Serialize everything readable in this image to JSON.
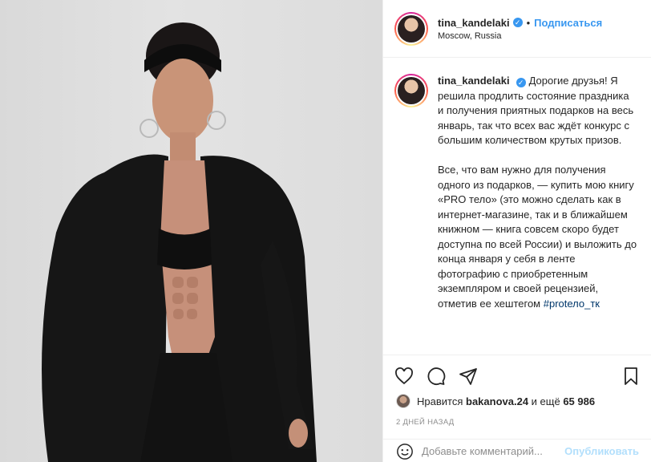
{
  "post": {
    "username": "tina_kandelaki",
    "follow_label": "Подписаться",
    "separator": "•",
    "location": "Moscow, Russia",
    "verified_icon": "verified-badge-icon",
    "caption_text": "Дорогие друзья! Я решила продлить состояние праздника и получения приятных подарков на весь январь, так что всех вас ждёт конкурс с большим количеством крутых призов.\n\nВсе, что вам нужно для получения одного из подарков, — купить мою книгу «PRO тело» (это можно сделать как в интернет-магазине, так и в ближайшем книжном — книга совсем скоро будет доступна по всей России) и выложить до конца января у себя в ленте фотографию с приобретенным экземпляром и своей рецензией, отметив ее хештегом ",
    "hashtag": "#protело_тк"
  },
  "actions": {
    "like_icon": "heart-icon",
    "comment_icon": "comment-icon",
    "share_icon": "share-icon",
    "save_icon": "bookmark-icon"
  },
  "likes": {
    "prefix": "Нравится",
    "user": "bakanova.24",
    "middle": "и ещё",
    "count": "65 986"
  },
  "timestamp": "2 ДНЕЙ НАЗАД",
  "comment": {
    "placeholder": "Добавьте комментарий...",
    "publish_label": "Опубликовать"
  },
  "colors": {
    "accent": "#3897f0",
    "publish_disabled": "#b2dffc",
    "hashtag": "#00376b",
    "muted": "#8e8e8e"
  }
}
